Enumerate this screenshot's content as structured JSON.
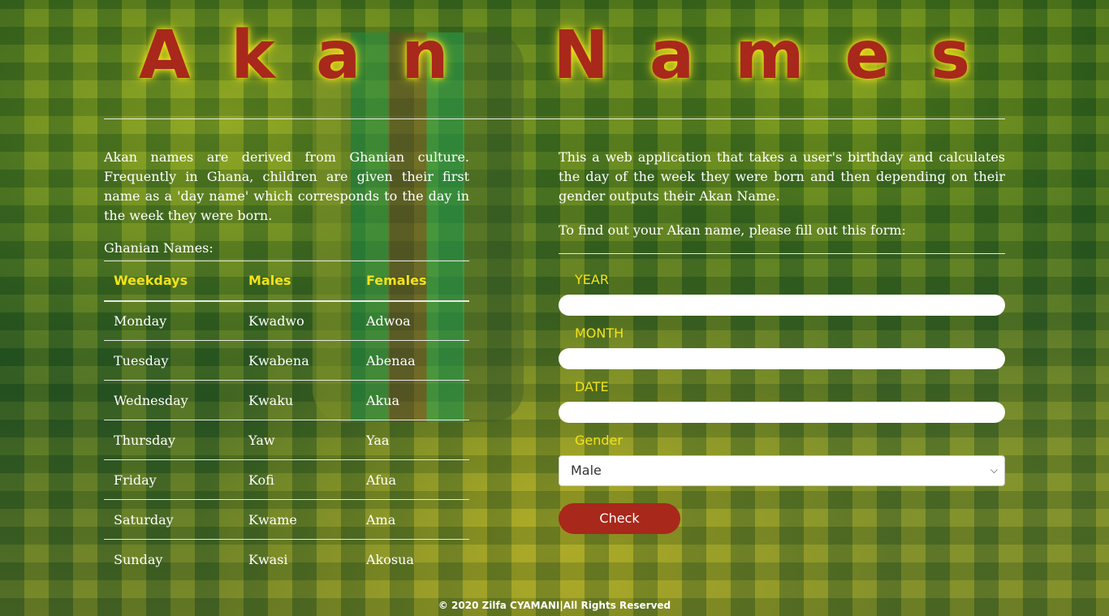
{
  "header": {
    "title": "Akan Names"
  },
  "intro": {
    "text": "Akan names are derived from Ghanian culture. Frequently in Ghana, children are given their first name as a 'day name' which corresponds to the day in the week they were born.",
    "table_label": "Ghanian Names:"
  },
  "names_table": {
    "headers": [
      "Weekdays",
      "Males",
      "Females"
    ],
    "rows": [
      [
        "Monday",
        "Kwadwo",
        "Adwoa"
      ],
      [
        "Tuesday",
        "Kwabena",
        "Abenaa"
      ],
      [
        "Wednesday",
        "Kwaku",
        "Akua"
      ],
      [
        "Thursday",
        "Yaw",
        "Yaa"
      ],
      [
        "Friday",
        "Kofi",
        "Afua"
      ],
      [
        "Saturday",
        "Kwame",
        "Ama"
      ],
      [
        "Sunday",
        "Kwasi",
        "Akosua"
      ]
    ]
  },
  "description": {
    "text": "This a web application that takes a user's birthday and calculates the day of the week they were born and then depending on their gender outputs their Akan Name.",
    "prompt": "To find out your Akan name, please fill out this form:"
  },
  "form": {
    "year_label": "YEAR",
    "month_label": "MONTH",
    "date_label": "DATE",
    "gender_label": "Gender",
    "gender_selected": "Male",
    "check_label": "Check"
  },
  "footer": {
    "text": "© 2020 Zilfa CYAMANI|All Rights Reserved"
  },
  "colors": {
    "accent_red": "#a8281b",
    "accent_yellow": "#f3e21a"
  }
}
